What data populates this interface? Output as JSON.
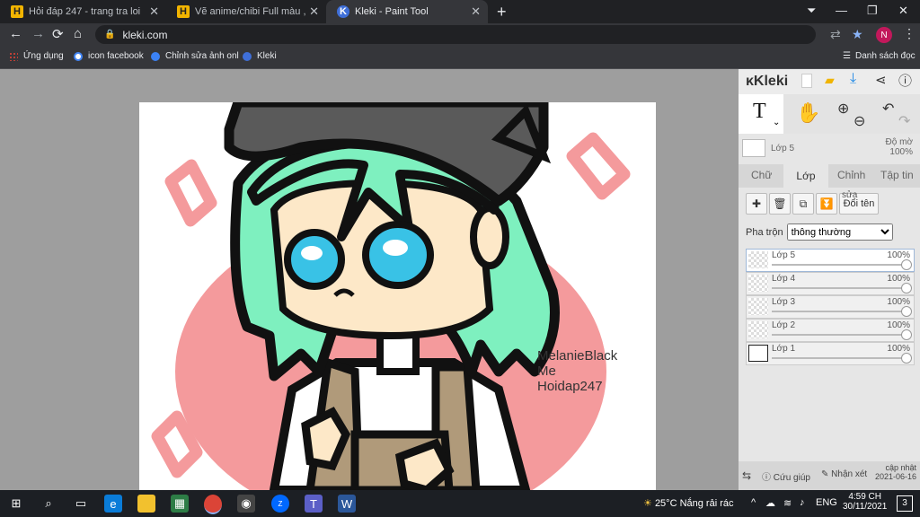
{
  "browser": {
    "tabs": [
      {
        "title": "Hỏi đáp 247 - trang tra loi",
        "favicon": "H",
        "close": "✕"
      },
      {
        "title": "Vẽ anime/chibi Full màu , tradi /c",
        "favicon": "H",
        "close": "✕"
      },
      {
        "title": "Kleki - Paint Tool",
        "favicon": "K",
        "close": "✕"
      }
    ],
    "new_tab": "+",
    "url": "kleki.com",
    "profile_initial": "N",
    "bookmarks": [
      {
        "label": "Ứng dụng",
        "icon": "apps-grid-icon"
      },
      {
        "label": "icon facebook",
        "icon": "link-icon"
      },
      {
        "label": "Chỉnh sửa ảnh onl",
        "icon": "photo-editor-icon"
      },
      {
        "label": "Kleki",
        "icon": "kleki-icon"
      }
    ],
    "reading_list": "Danh sách đọc"
  },
  "canvas": {
    "signature_lines": [
      "MelanieBlack",
      "Me",
      "Hoidap247"
    ],
    "colors": {
      "hair": "#7ef0bf",
      "circle": "#f49a9c",
      "skin": "#fde8c8",
      "eye": "#39c2e6",
      "apron": "#b09a7a",
      "outline": "#111111"
    }
  },
  "kleki": {
    "brand": "Kleki",
    "current_layer": {
      "name": "Lớp 5",
      "opacity_label": "Độ mờ",
      "opacity": "100%"
    },
    "tabs": [
      "Chữ",
      "Lớp",
      "Chỉnh",
      "Tập tin"
    ],
    "active_tab": "Lớp",
    "rename_button": "Đổi tên",
    "rename_overlay": "sửa",
    "blend_label": "Pha trộn",
    "blend_value": "thông thường",
    "layers": [
      {
        "name": "Lớp 5",
        "opacity": "100%"
      },
      {
        "name": "Lớp 4",
        "opacity": "100%"
      },
      {
        "name": "Lớp 3",
        "opacity": "100%"
      },
      {
        "name": "Lớp 2",
        "opacity": "100%"
      },
      {
        "name": "Lớp 1",
        "opacity": "100%"
      }
    ],
    "footer": {
      "help": "Cứu giúp",
      "feedback": "Nhận xét",
      "update_label": "cập nhật",
      "update_date": "2021-06-16"
    }
  },
  "taskbar": {
    "weather": "25°C  Nắng rải rác",
    "language": "ENG",
    "time": "4:59 CH",
    "date": "30/11/2021",
    "notifications": "3"
  }
}
